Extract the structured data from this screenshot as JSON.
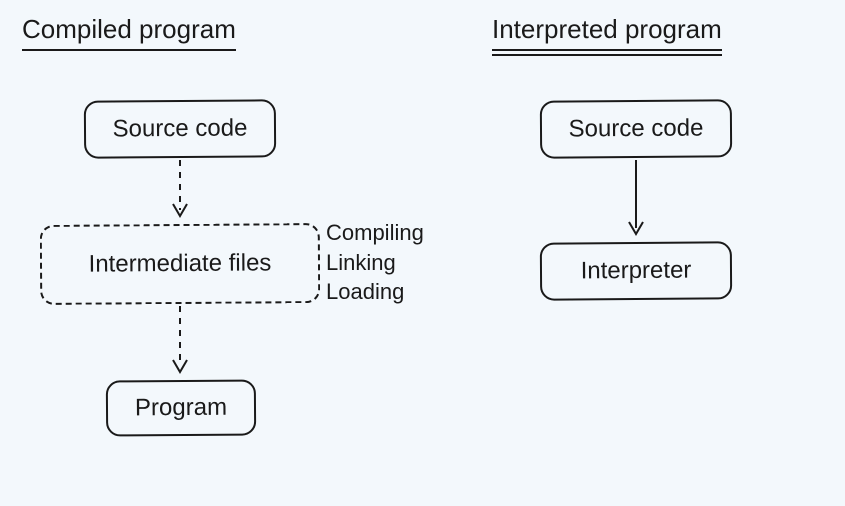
{
  "left": {
    "title": "Compiled program",
    "node_source": "Source code",
    "node_intermediate": "Intermediate files",
    "node_program": "Program",
    "annotations": {
      "a1": "Compiling",
      "a2": "Linking",
      "a3": "Loading"
    }
  },
  "right": {
    "title": "Interpreted program",
    "node_source": "Source code",
    "node_interpreter": "Interpreter"
  },
  "chart_data": {
    "type": "flow",
    "diagrams": [
      {
        "title": "Compiled program",
        "nodes": [
          {
            "id": "c_source",
            "label": "Source code",
            "style": "solid"
          },
          {
            "id": "c_intermediate",
            "label": "Intermediate files",
            "style": "dashed",
            "annotations": [
              "Compiling",
              "Linking",
              "Loading"
            ]
          },
          {
            "id": "c_program",
            "label": "Program",
            "style": "solid"
          }
        ],
        "edges": [
          {
            "from": "c_source",
            "to": "c_intermediate",
            "style": "dashed"
          },
          {
            "from": "c_intermediate",
            "to": "c_program",
            "style": "dashed"
          }
        ]
      },
      {
        "title": "Interpreted program",
        "nodes": [
          {
            "id": "i_source",
            "label": "Source code",
            "style": "solid"
          },
          {
            "id": "i_interpreter",
            "label": "Interpreter",
            "style": "solid"
          }
        ],
        "edges": [
          {
            "from": "i_source",
            "to": "i_interpreter",
            "style": "solid"
          }
        ]
      }
    ]
  }
}
